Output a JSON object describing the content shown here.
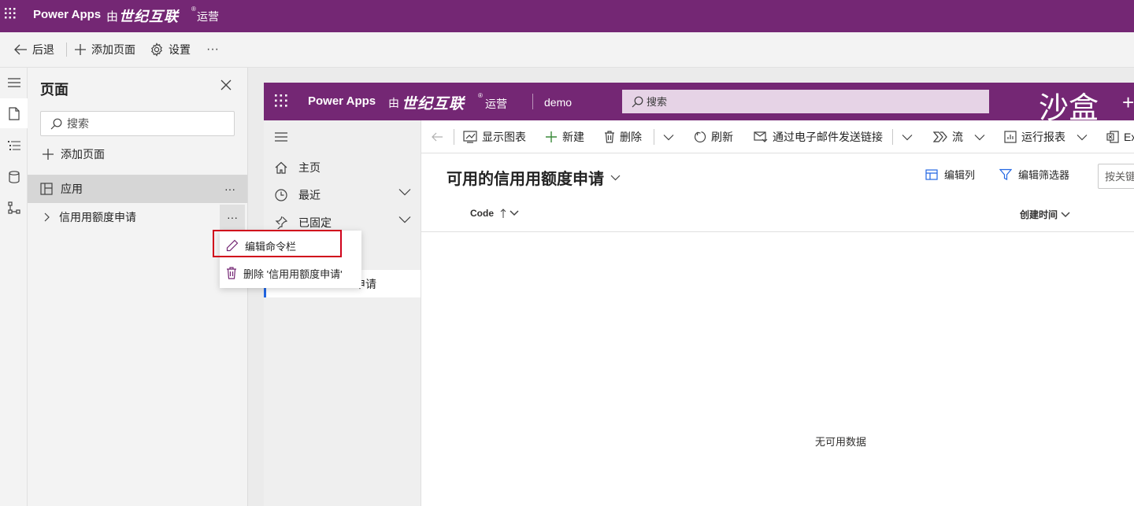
{
  "topbar": {
    "app_name": "Power Apps",
    "by_label": "由",
    "brand": "世纪互联",
    "reg_mark": "®",
    "operated_label": "运营"
  },
  "commandbar": {
    "back_label": "后退",
    "add_page_label": "添加页面",
    "settings_label": "设置",
    "more_label": "···"
  },
  "pages_panel": {
    "title": "页面",
    "search_placeholder": "搜索",
    "add_page_label": "添加页面",
    "app_row_label": "应用",
    "page_row_label": "信用用额度申请",
    "dots": "···"
  },
  "context_menu": {
    "edit_command_bar": "编辑命令栏",
    "delete_page": "删除 '信用用额度申请'"
  },
  "preview": {
    "header": {
      "app_name": "Power Apps",
      "by_label": "由",
      "brand": "世纪互联",
      "reg_mark": "®",
      "operated_label": "运营",
      "environment": "demo",
      "search_placeholder": "搜索",
      "sandbox_label": "沙盒",
      "plus_label": "+"
    },
    "nav": {
      "home": "主页",
      "recent": "最近",
      "pinned": "已固定",
      "selected_item_partial": "申请"
    },
    "toolbar": {
      "show_chart": "显示图表",
      "new": "新建",
      "delete": "删除",
      "refresh": "刷新",
      "email_link": "通过电子邮件发送链接",
      "flow": "流",
      "run_report": "运行报表",
      "excel_partial": "Ex"
    },
    "view": {
      "title": "可用的信用用额度申请",
      "edit_columns": "编辑列",
      "edit_filters": "编辑筛选器",
      "keyword_search_placeholder": "按关键",
      "col_code": "Code",
      "col_created": "创建时间",
      "empty_message": "无可用数据"
    }
  },
  "colors": {
    "brand_purple": "#742774",
    "search_bg": "#e6d3e6",
    "highlight_red": "#d0021b",
    "accent_blue": "#2266e3"
  }
}
